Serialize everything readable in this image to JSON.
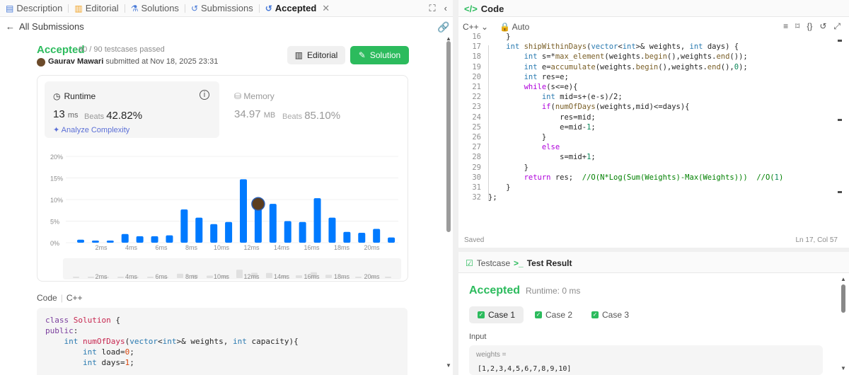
{
  "tabs": [
    {
      "label": "Description",
      "icon": "description-icon"
    },
    {
      "label": "Editorial",
      "icon": "book-icon"
    },
    {
      "label": "Solutions",
      "icon": "flask-icon"
    },
    {
      "label": "Submissions",
      "icon": "history-icon"
    },
    {
      "label": "Accepted",
      "icon": "accepted-history-icon"
    }
  ],
  "back_label": "All Submissions",
  "submission": {
    "status": "Accepted",
    "testcases": "90 / 90 testcases passed",
    "author": "Gaurav Mawari",
    "submitted_text": "submitted at Nov 18, 2025 23:31",
    "editorial_button": "Editorial",
    "solution_button": "Solution"
  },
  "runtime": {
    "label": "Runtime",
    "value": "13",
    "unit": "ms",
    "beats_label": "Beats",
    "beats_value": "42.82%",
    "analyze_label": "Analyze Complexity"
  },
  "memory": {
    "label": "Memory",
    "value": "34.97",
    "unit": "MB",
    "beats_label": "Beats",
    "beats_value": "85.10%"
  },
  "chart_data": {
    "type": "bar",
    "y_ticks": [
      "20%",
      "15%",
      "10%",
      "5%",
      "0%"
    ],
    "ylim": [
      0,
      20
    ],
    "x_ticks": [
      "2ms",
      "4ms",
      "6ms",
      "8ms",
      "10ms",
      "12ms",
      "14ms",
      "16ms",
      "18ms",
      "20ms"
    ],
    "values": [
      0.7,
      0.5,
      0.5,
      2.0,
      1.5,
      1.5,
      1.7,
      7.7,
      5.8,
      4.3,
      4.8,
      14.7,
      9.3,
      9.0,
      5.0,
      4.8,
      10.3,
      5.8,
      2.5,
      2.3,
      3.2,
      1.2
    ],
    "highlight_index": 12,
    "color": "#007aff"
  },
  "code_section": {
    "label": "Code",
    "language": "C++",
    "lines": [
      "class Solution {",
      "public:",
      "    int numOfDays(vector<int>& weights, int capacity){",
      "        int load=0;",
      "        int days=1;"
    ]
  },
  "editor": {
    "title": "Code",
    "language": "C++",
    "mode": "Auto",
    "status": "Saved",
    "cursor": "Ln 17, Col 57",
    "line_numbers": [
      "16",
      "17",
      "18",
      "19",
      "20",
      "21",
      "22",
      "23",
      "24",
      "25",
      "26",
      "27",
      "28",
      "29",
      "30",
      "31",
      "32"
    ],
    "lines": [
      "    }",
      "    int shipWithinDays(vector<int>& weights, int days) {",
      "        int s=*max_element(weights.begin(),weights.end());",
      "        int e=accumulate(weights.begin(),weights.end(),0);",
      "        int res=e;",
      "        while(s<=e){",
      "            int mid=s+(e-s)/2;",
      "            if(numOfDays(weights,mid)<=days){",
      "                res=mid;",
      "                e=mid-1;",
      "            }",
      "            else",
      "                s=mid+1;",
      "        }",
      "        return res;  //O(N*Log(Sum(Weights)-Max(Weights)))  //O(1)",
      "    }",
      "};"
    ]
  },
  "testpanel": {
    "testcase_tab": "Testcase",
    "result_tab": "Test Result",
    "status": "Accepted",
    "runtime": "Runtime: 0 ms",
    "cases": [
      "Case 1",
      "Case 2",
      "Case 3"
    ],
    "input_label": "Input",
    "param_name": "weights =",
    "param_value": "[1,2,3,4,5,6,7,8,9,10]"
  }
}
